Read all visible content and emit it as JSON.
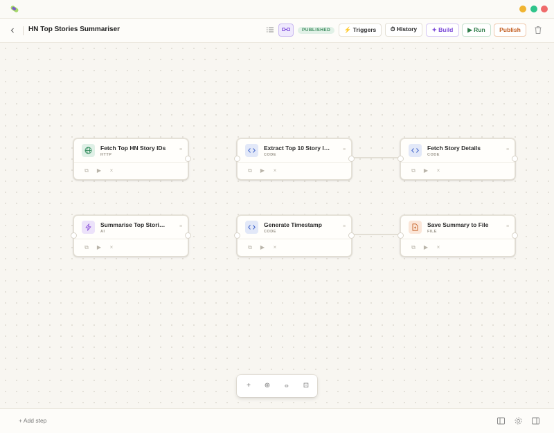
{
  "header": {
    "title": "HN Top Stories Summariser",
    "status_badge": "PUBLISHED",
    "triggers_label": "⚡ Triggers",
    "history_label": "⏱ History",
    "build_label": "✦ Build",
    "run_label": "▶ Run",
    "publish_label": "Publish"
  },
  "nodes": [
    {
      "title": "Fetch Top HN Story IDs",
      "type": "HTTP",
      "icon": "globe-icon"
    },
    {
      "title": "Extract Top 10 Story I…",
      "type": "CODE",
      "icon": "code-icon"
    },
    {
      "title": "Fetch Story Details",
      "type": "CODE",
      "icon": "code-icon"
    },
    {
      "title": "Summarise Top Stori…",
      "type": "AI",
      "icon": "lightning-icon"
    },
    {
      "title": "Generate Timestamp",
      "type": "CODE",
      "icon": "code-icon"
    },
    {
      "title": "Save Summary to File",
      "type": "FILE",
      "icon": "file-icon"
    }
  ],
  "node_actions": {
    "duplicate": "⧉",
    "run": "▶",
    "delete": "×",
    "menu": "≡"
  },
  "zoom_toolbar": {
    "zoom_in": "+",
    "zoom_out": "⊕",
    "fit": "⦵",
    "frame": "⊡"
  },
  "footer": {
    "add_step": "+ Add step"
  },
  "colors": {
    "accent_purple": "#7c4ad8",
    "run_green": "#2f7d49",
    "publish_orange": "#c45e21",
    "published_green": "#3b8a5c"
  }
}
